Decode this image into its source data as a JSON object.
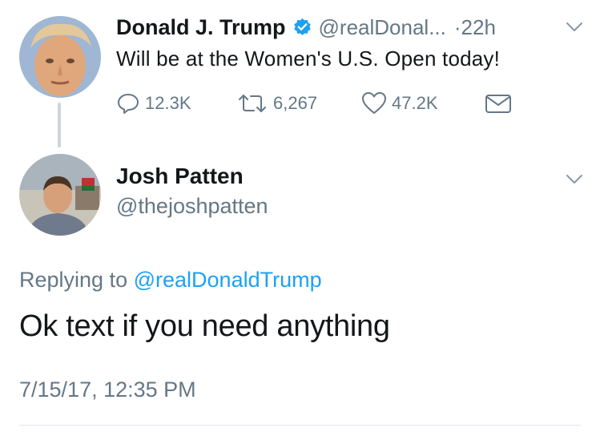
{
  "original_tweet": {
    "author_name": "Donald J. Trump",
    "verified": true,
    "handle": "@realDonal...",
    "time": "·22h",
    "text": "Will be at the Women's U.S. Open today!",
    "actions": {
      "replies": "12.3K",
      "retweets": "6,267",
      "likes": "47.2K"
    }
  },
  "reply_tweet": {
    "author_name": "Josh Patten",
    "handle": "@thejoshpatten",
    "replying_prefix": "Replying to",
    "replying_to": "@realDonaldTrump",
    "text": "Ok text if you need anything",
    "timestamp": "7/15/17, 12:35 PM"
  },
  "colors": {
    "text_primary": "#14171a",
    "text_secondary": "#657786",
    "link": "#1da1f2",
    "verified_badge": "#1da1f2",
    "thread_line": "#ccd6dd"
  }
}
